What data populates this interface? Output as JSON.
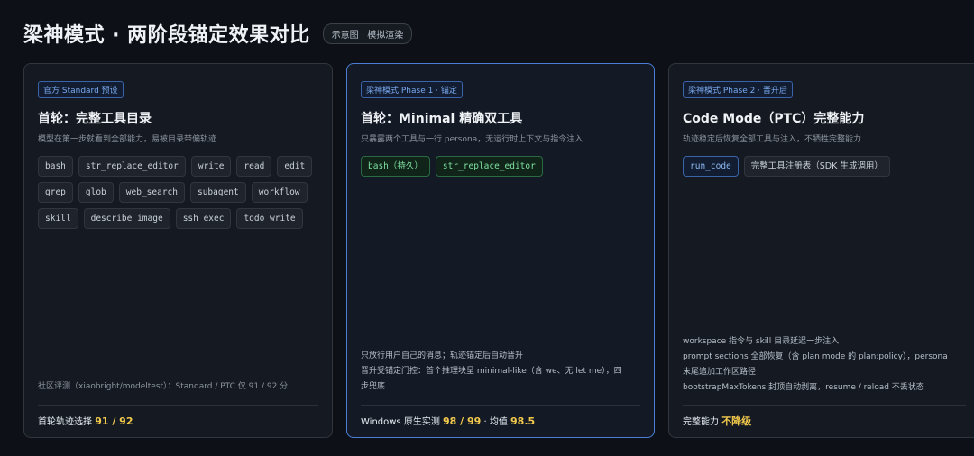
{
  "header": {
    "title": "梁神模式 · 两阶段锚定效果对比",
    "badge": "示意图 · 模拟渲染"
  },
  "cards": [
    {
      "tag": "官方 Standard 预设",
      "title": "首轮：完整工具目录",
      "desc": "模型在第一步就看到全部能力，易被目录带偏轨迹",
      "chips": [
        "bash",
        "str_replace_editor",
        "write",
        "read",
        "edit",
        "grep",
        "glob",
        "web_search",
        "subagent",
        "workflow",
        "skill",
        "describe_image",
        "ssh_exec",
        "todo_write"
      ],
      "notes": [
        "社区评测（xiaobright/modeltest）：Standard / PTC 仅 91 / 92 分"
      ],
      "footer_label": "首轮轨迹选择",
      "footer_value": "91 / 92"
    },
    {
      "tag": "梁神模式 Phase 1 · 锚定",
      "title": "首轮：Minimal 精确双工具",
      "desc": "只暴露两个工具与一行 persona，无运行时上下文与指令注入",
      "chips": [
        "bash（持久）",
        "str_replace_editor"
      ],
      "notes": [
        "只放行用户自己的消息；轨迹锚定后自动晋升",
        "晋升受锚定门控：首个推理块呈 minimal-like（含 we、无 let me），四",
        "步兜底"
      ],
      "footer_label": "Windows 原生实测",
      "footer_value": "98 / 99",
      "footer_sep": " · 均值 ",
      "footer_value2": "98.5"
    },
    {
      "tag": "梁神模式 Phase 2 · 晋升后",
      "title": "Code Mode（PTC）完整能力",
      "desc": "轨迹稳定后恢复全部工具与注入，不牺牲完整能力",
      "chips": [
        "run_code",
        "完整工具注册表（SDK 生成调用）"
      ],
      "notes": [
        "workspace 指令与 skill 目录延迟一步注入",
        "prompt sections 全部恢复（含 plan mode 的 plan:policy），persona",
        "末尾追加工作区路径",
        "bootstrapMaxTokens 封顶自动剥离，resume / reload 不丢状态"
      ],
      "footer_label": "完整能力",
      "footer_value": "不降级"
    }
  ]
}
